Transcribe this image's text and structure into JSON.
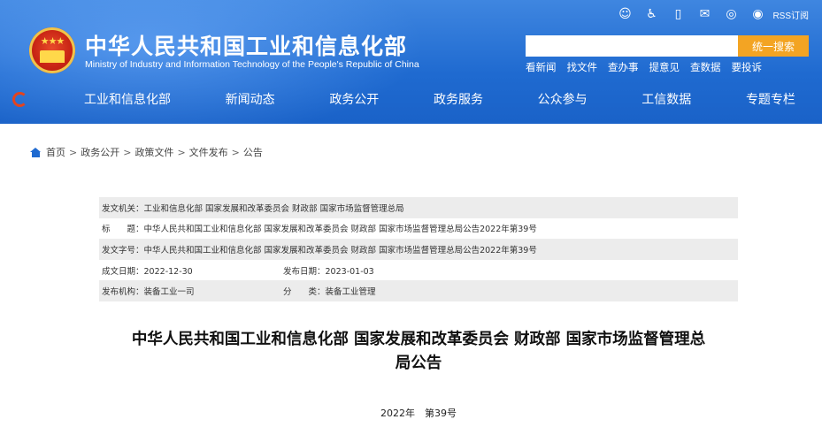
{
  "header": {
    "title": "中华人民共和国工业和信息化部",
    "subtitle": "Ministry of Industry and Information Technology of the People's Republic of China",
    "rss_label": "RSS订阅",
    "search": {
      "placeholder": "",
      "button_label": "统一搜索"
    },
    "quick_links": [
      "看新闻",
      "找文件",
      "查办事",
      "提意见",
      "查数据",
      "要投诉"
    ]
  },
  "nav": {
    "items": [
      "工业和信息化部",
      "新闻动态",
      "政务公开",
      "政务服务",
      "公众参与",
      "工信数据",
      "专题专栏"
    ]
  },
  "breadcrumb": [
    "首页",
    "政务公开",
    "政策文件",
    "文件发布",
    "公告"
  ],
  "meta": {
    "issuer_label": "发文机关：",
    "issuer": "工业和信息化部 国家发展和改革委员会 财政部 国家市场监督管理总局",
    "title_label": "标　　题：",
    "title": "中华人民共和国工业和信息化部 国家发展和改革委员会 财政部 国家市场监督管理总局公告2022年第39号",
    "docno_label": "发文字号：",
    "docno": "中华人民共和国工业和信息化部 国家发展和改革委员会 财政部 国家市场监督管理总局公告2022年第39号",
    "written_label": "成文日期：",
    "written": "2022-12-30",
    "published_label": "发布日期：",
    "published": "2023-01-03",
    "org_label": "发布机构：",
    "org": "装备工业一司",
    "category_label": "分　　类：",
    "category": "装备工业管理"
  },
  "document": {
    "title_line1": "中华人民共和国工业和信息化部 国家发展和改革委员会 财政部 国家市场监督管理总",
    "title_line2": "局公告",
    "number": "2022年　第39号"
  }
}
